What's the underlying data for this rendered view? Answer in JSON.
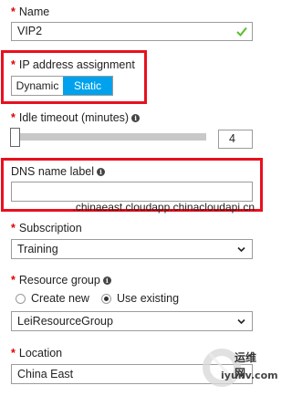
{
  "name": {
    "required": "*",
    "label": "Name",
    "value": "VIP2"
  },
  "ip_assignment": {
    "required": "*",
    "label": "IP address assignment",
    "options": [
      "Dynamic",
      "Static"
    ],
    "selected": "Static"
  },
  "idle_timeout": {
    "required": "*",
    "label": "Idle timeout (minutes)",
    "value": "4",
    "slider_fraction": 0.0
  },
  "dns": {
    "label": "DNS name label",
    "value": "",
    "suffix": ".chinaeast.cloudapp.chinacloudapi.cn"
  },
  "subscription": {
    "required": "*",
    "label": "Subscription",
    "value": "Training"
  },
  "resource_group": {
    "required": "*",
    "label": "Resource group",
    "option_new": "Create new",
    "option_existing": "Use existing",
    "selected": "Use existing",
    "value": "LeiResourceGroup"
  },
  "location": {
    "required": "*",
    "label": "Location",
    "value": "China East"
  },
  "watermark": {
    "text_cn": "运维网",
    "text_url": "iyunv.com"
  },
  "colors": {
    "accent": "#00a2ed",
    "highlight": "#e8101e",
    "valid": "#5bbd2b"
  }
}
